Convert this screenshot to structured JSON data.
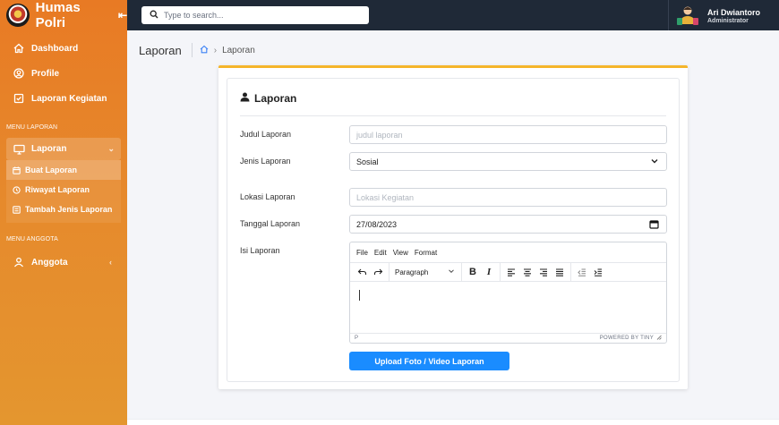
{
  "app": {
    "title": "Humas Polri"
  },
  "sidebar": {
    "items": [
      {
        "label": "Dashboard",
        "icon": "home-icon"
      },
      {
        "label": "Profile",
        "icon": "user-circle-icon"
      },
      {
        "label": "Laporan Kegiatan",
        "icon": "checkbox-icon"
      }
    ],
    "section1": "MENU LAPORAN",
    "laporan": {
      "label": "Laporan",
      "children": [
        {
          "label": "Buat Laporan",
          "icon": "calendar-icon",
          "active": true
        },
        {
          "label": "Riwayat Laporan",
          "icon": "history-icon",
          "active": false
        },
        {
          "label": "Tambah Jenis Laporan",
          "icon": "list-icon",
          "active": false
        }
      ]
    },
    "section2": "MENU ANGGOTA",
    "anggota": {
      "label": "Anggota",
      "icon": "user-icon"
    }
  },
  "topbar": {
    "search_placeholder": "Type to search...",
    "user_name": "Ari Dwiantoro",
    "user_role": "Administrator"
  },
  "breadcrumb": {
    "page_title": "Laporan",
    "current": "Laporan"
  },
  "form": {
    "title": "Laporan",
    "judul": {
      "label": "Judul Laporan",
      "placeholder": "judul laporan",
      "value": ""
    },
    "jenis": {
      "label": "Jenis Laporan",
      "value": "Sosial"
    },
    "lokasi": {
      "label": "Lokasi Laporan",
      "placeholder": "Lokasi Kegiatan",
      "value": ""
    },
    "tanggal": {
      "label": "Tanggal Laporan",
      "value": "27/08/2023"
    },
    "isi": {
      "label": "Isi Laporan"
    },
    "editor": {
      "menus": [
        "File",
        "Edit",
        "View",
        "Format"
      ],
      "block_format": "Paragraph",
      "status_path": "P",
      "powered_by": "POWERED BY TINY"
    },
    "upload_label": "Upload Foto / Video Laporan"
  },
  "colors": {
    "sidebar": "#e87a24",
    "topbar": "#1f2937",
    "card_accent": "#f5b52b",
    "primary_button": "#1a8cff"
  }
}
